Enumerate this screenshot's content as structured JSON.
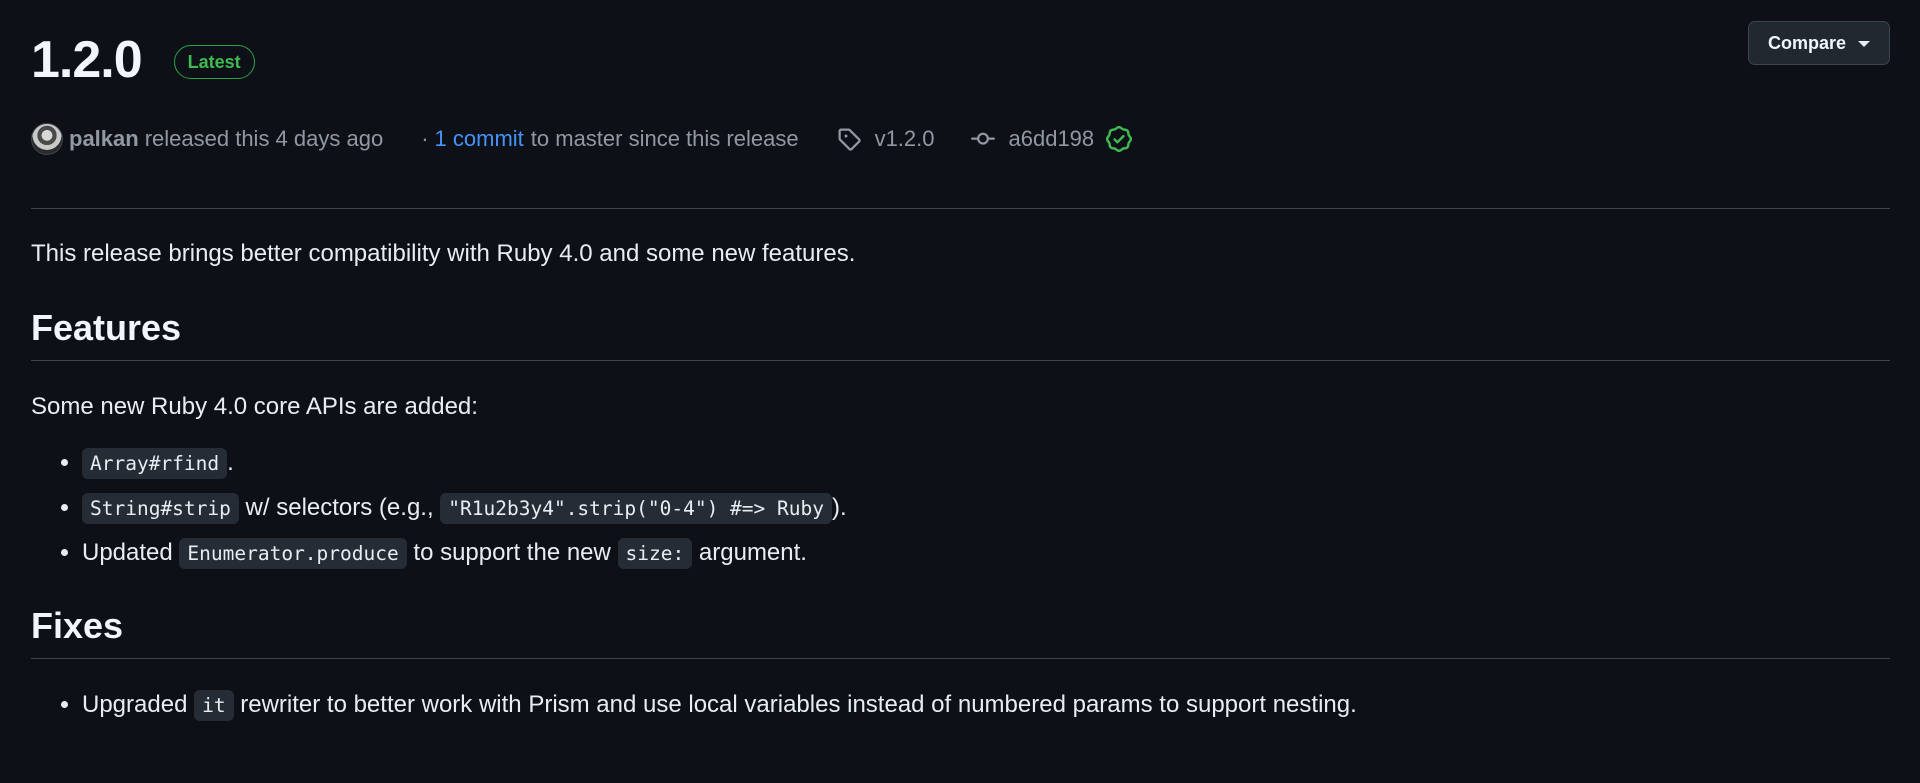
{
  "release": {
    "title": "1.2.0",
    "badge": "Latest",
    "compare_label": "Compare"
  },
  "meta": {
    "author": "palkan",
    "released_text": "released this 4 days ago",
    "separator": "·",
    "commit_link": "1 commit",
    "commit_suffix": "to master since this release",
    "tag": "v1.2.0",
    "sha": "a6dd198"
  },
  "body": {
    "intro": "This release brings better compatibility with Ruby 4.0 and some new features.",
    "features": {
      "heading": "Features",
      "lead": "Some new Ruby 4.0 core APIs are added:",
      "items": [
        {
          "code": "Array#rfind",
          "after": "."
        },
        {
          "code1": "String#strip",
          "mid": " w/ selectors (e.g., ",
          "code2": "\"R1u2b3y4\".strip(\"0-4\") #=> Ruby",
          "after": ")."
        },
        {
          "before": "Updated ",
          "code1": "Enumerator.produce",
          "mid": " to support the new ",
          "code2": "size:",
          "after": " argument."
        }
      ]
    },
    "fixes": {
      "heading": "Fixes",
      "items": [
        {
          "before": "Upgraded ",
          "code": "it",
          "after": " rewriter to better work with Prism and use local variables instead of numbered params to support nesting."
        }
      ]
    }
  },
  "colors": {
    "background": "#0d1117",
    "link": "#4493f8",
    "success": "#3fb950",
    "muted": "#9198a1"
  },
  "icons": {
    "tag": "tag-icon",
    "commit": "git-commit-icon",
    "verified": "verified-check-icon",
    "caret": "triangle-down-icon"
  }
}
